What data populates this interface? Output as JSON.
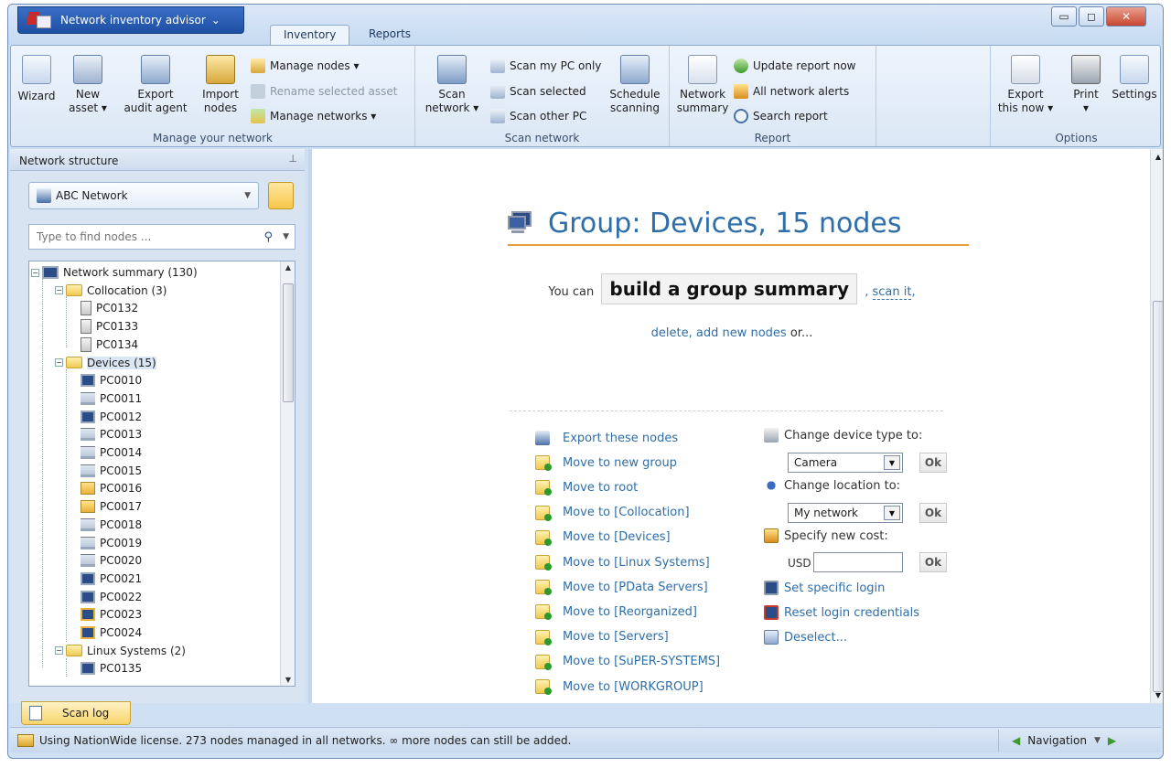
{
  "app": {
    "menu_label": "Network inventory advisor",
    "tabs": [
      "Inventory",
      "Reports"
    ]
  },
  "ribbon": {
    "manage": {
      "label": "Manage your network",
      "wizard": "Wizard",
      "new_asset": [
        "New",
        "asset"
      ],
      "export_agent": [
        "Export",
        "audit agent"
      ],
      "import_nodes": [
        "Import",
        "nodes"
      ],
      "manage_nodes": "Manage nodes",
      "rename_asset": "Rename selected asset",
      "manage_networks": "Manage networks"
    },
    "scan": {
      "label": "Scan network",
      "scan_network": [
        "Scan",
        "network"
      ],
      "scan_my_pc": "Scan my PC only",
      "scan_selected": "Scan selected",
      "scan_other": "Scan other PC",
      "schedule": [
        "Schedule",
        "scanning"
      ]
    },
    "report": {
      "label": "Report",
      "network_summary": [
        "Network",
        "summary"
      ],
      "update_report": "Update report now",
      "all_alerts": "All network alerts",
      "search_report": "Search report"
    },
    "options": {
      "label": "Options",
      "export_now": [
        "Export",
        "this now"
      ],
      "print": "Print",
      "settings": "Settings"
    }
  },
  "left_panel": {
    "title": "Network structure",
    "network": "ABC Network",
    "search_placeholder": "Type to find nodes ...",
    "tree": [
      {
        "label": "Network summary (130)",
        "level": 0,
        "type": "root"
      },
      {
        "label": "Collocation (3)",
        "level": 1,
        "type": "folder"
      },
      {
        "label": "PC0132",
        "level": 2,
        "type": "server"
      },
      {
        "label": "PC0133",
        "level": 2,
        "type": "server"
      },
      {
        "label": "PC0134",
        "level": 2,
        "type": "server"
      },
      {
        "label": "Devices (15)",
        "level": 1,
        "type": "folder",
        "selected": true
      },
      {
        "label": "PC0010",
        "level": 2,
        "type": "monitor"
      },
      {
        "label": "PC0011",
        "level": 2,
        "type": "laptop"
      },
      {
        "label": "PC0012",
        "level": 2,
        "type": "monitor"
      },
      {
        "label": "PC0013",
        "level": 2,
        "type": "laptop"
      },
      {
        "label": "PC0014",
        "level": 2,
        "type": "laptop"
      },
      {
        "label": "PC0015",
        "level": 2,
        "type": "laptop"
      },
      {
        "label": "PC0016",
        "level": 2,
        "type": "yellow"
      },
      {
        "label": "PC0017",
        "level": 2,
        "type": "yellow"
      },
      {
        "label": "PC0018",
        "level": 2,
        "type": "laptop"
      },
      {
        "label": "PC0019",
        "level": 2,
        "type": "laptop"
      },
      {
        "label": "PC0020",
        "level": 2,
        "type": "laptop"
      },
      {
        "label": "PC0021",
        "level": 2,
        "type": "monitor"
      },
      {
        "label": "PC0022",
        "level": 2,
        "type": "monitor"
      },
      {
        "label": "PC0023",
        "level": 2,
        "type": "ylap"
      },
      {
        "label": "PC0024",
        "level": 2,
        "type": "ylap"
      },
      {
        "label": "Linux Systems (2)",
        "level": 1,
        "type": "folder"
      },
      {
        "label": "PC0135",
        "level": 2,
        "type": "monitor"
      }
    ]
  },
  "main": {
    "heading": "Group: Devices, 15 nodes",
    "you_can": "You can",
    "build_summary": "build a group summary",
    "comma1": ",",
    "scan_it": "scan it",
    "comma2": ",",
    "delete": "delete",
    "comma3": ",",
    "add_nodes": "add new nodes",
    "or": "or...",
    "actions": [
      "Export these nodes",
      "Move to new group",
      "Move to root",
      "Move to [Collocation]",
      "Move to [Devices]",
      "Move to [Linux Systems]",
      "Move to [PData Servers]",
      "Move to [Reorganized]",
      "Move to [Servers]",
      "Move to [SuPER-SYSTEMS]",
      "Move to [WORKGROUP]"
    ],
    "change_type_label": "Change device type to:",
    "device_type_value": "Camera",
    "change_location_label": "Change location to:",
    "location_value": "My network",
    "new_cost_label": "Specify new cost:",
    "currency": "USD",
    "ok": "Ok",
    "set_login": "Set specific login",
    "reset_login": "Reset login credentials",
    "deselect": "Deselect..."
  },
  "bottom": {
    "scan_log": "Scan log",
    "status": "Using NationWide license. 273 nodes managed in all networks. ∞ more nodes can still be added.",
    "navigation": "Navigation"
  },
  "colors": {
    "accent": "#2e6ea9",
    "heading_underline": "#e69c39",
    "frame": "#cfe0f3"
  }
}
